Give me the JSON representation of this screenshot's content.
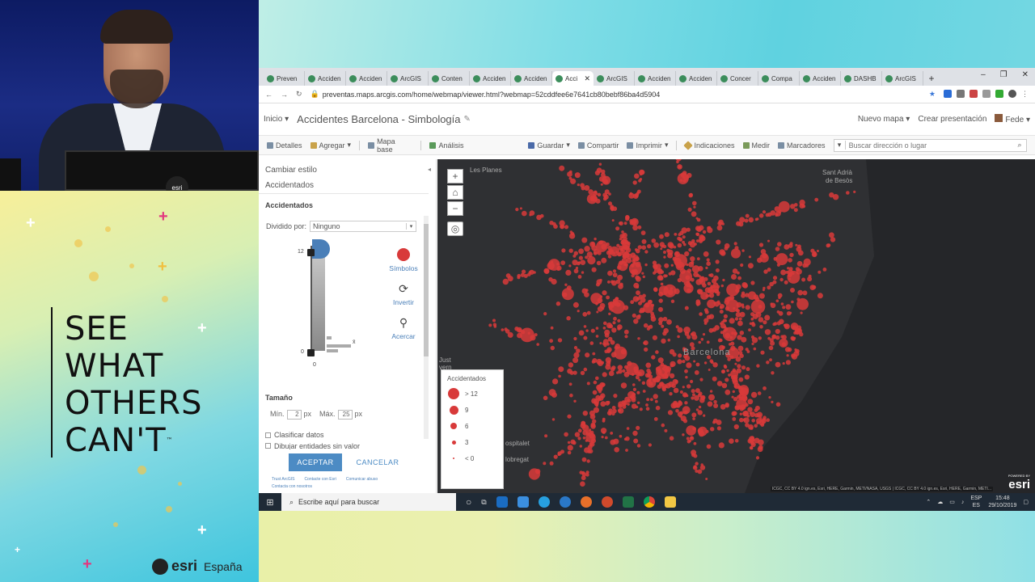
{
  "branding": {
    "tagline_lines": [
      "SEE",
      "WHAT",
      "OTHERS",
      "CAN'T"
    ],
    "tagline_tm": "™",
    "logo_word": "esri",
    "logo_country": "España",
    "badge": "esri"
  },
  "browser": {
    "tabs": [
      {
        "label": "Preven",
        "active": false
      },
      {
        "label": "Acciden",
        "active": false
      },
      {
        "label": "Acciden",
        "active": false
      },
      {
        "label": "ArcGIS",
        "active": false
      },
      {
        "label": "Conten",
        "active": false
      },
      {
        "label": "Acciden",
        "active": false
      },
      {
        "label": "Acciden",
        "active": false
      },
      {
        "label": "Acci",
        "active": true
      },
      {
        "label": "ArcGIS",
        "active": false
      },
      {
        "label": "Acciden",
        "active": false
      },
      {
        "label": "Acciden",
        "active": false
      },
      {
        "label": "Concer",
        "active": false
      },
      {
        "label": "Compa",
        "active": false
      },
      {
        "label": "Acciden",
        "active": false
      },
      {
        "label": "DASHB",
        "active": false
      },
      {
        "label": "ArcGIS",
        "active": false
      }
    ],
    "new_tab": "+",
    "url": "preventas.maps.arcgis.com/home/webmap/viewer.html?webmap=52cddfee6e7641cb80bebf86ba4d5904"
  },
  "header": {
    "home": "Inicio",
    "title": "Accidentes Barcelona - Simbología",
    "new_map": "Nuevo mapa",
    "create_presentation": "Crear presentación",
    "user": "Fede"
  },
  "toolbar": {
    "details": "Detalles",
    "add": "Agregar",
    "basemap": "Mapa base",
    "analysis": "Análisis",
    "save": "Guardar",
    "share": "Compartir",
    "print": "Imprimir",
    "directions": "Indicaciones",
    "measure": "Medir",
    "bookmarks": "Marcadores",
    "search_placeholder": "Buscar dirección o lugar"
  },
  "panel": {
    "change_style": "Cambiar estilo",
    "layer_link": "Accidentados",
    "section_title": "Accidentados",
    "divided_by_label": "Dividido por:",
    "divided_by_value": "Ninguno",
    "histo_max": "12",
    "histo_min": "0",
    "histo_zero_bottom": "0",
    "histo_mean": "x̄",
    "symbols": "Símbolos",
    "invert": "Invertir",
    "zoom": "Acercar",
    "size_title": "Tamaño",
    "min_label": "Mín.",
    "min_value": "2",
    "max_label": "Máx.",
    "max_value": "25",
    "px": "px",
    "classify": "Clasificar datos",
    "draw_no_value": "Dibujar entidades sin valor",
    "accept": "ACEPTAR",
    "cancel": "CANCELAR",
    "footer": [
      "Trust ArcGIS",
      "Contacte con Esri",
      "Comunicar abuso",
      "Contacta con nosotros"
    ]
  },
  "map": {
    "places": {
      "las_planes": "Les Planes",
      "sant_adria": "Sant Adrià",
      "de_besos": "de Besòs",
      "barcelona": "Barcelona",
      "just": "Just",
      "vern": "vern",
      "hospitalet": "ospitalet",
      "llobregat": "lobregat"
    },
    "legend": {
      "title": "Accidentados",
      "items": [
        "> 12",
        "9",
        "6",
        "3",
        "< 0"
      ]
    },
    "attribution": "ICGC, CC BY 4.0 ign.es, Esri, HERE, Garmin, METI/NASA, USGS | ICGC, CC BY 4.0 ign.es, Esri, HERE, Garmin, METI...",
    "powered_by": "POWERED BY",
    "esri": "esri",
    "point_color": "#d83a3a"
  },
  "taskbar": {
    "search": "Escribe aquí para buscar",
    "lang": "ESP",
    "lang2": "ES",
    "time": "15:48",
    "date": "29/10/2019"
  }
}
